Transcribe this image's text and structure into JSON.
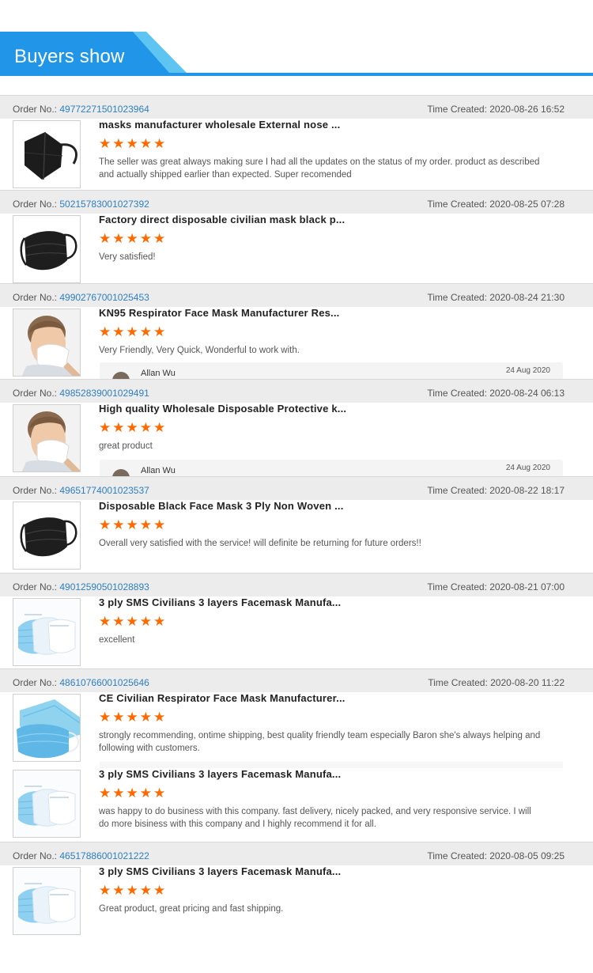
{
  "header": {
    "title": "Buyers show",
    "accent": "#2196e8",
    "accent_light": "#5ec4f2"
  },
  "labels": {
    "order_no": "Order No.:",
    "time_created": "Time Created:"
  },
  "orders": [
    {
      "order_no": "49772271501023964",
      "time": "2020-08-26 16:52",
      "items": [
        {
          "title": "masks manufacturer wholesale External nose ...",
          "rating": 5,
          "comment": "The seller was great always making sure I had all the updates on the status of my order. product as described and actually shipped earlier than expected. Super recomended",
          "thumb": "black-kn95-mask"
        }
      ]
    },
    {
      "order_no": "50215783001027392",
      "time": "2020-08-25 07:28",
      "items": [
        {
          "title": "Factory direct disposable civilian mask black p...",
          "rating": 5,
          "comment": "Very satisfied!",
          "thumb": "black-flat-mask"
        }
      ]
    },
    {
      "order_no": "49902767001025453",
      "time": "2020-08-24 21:30",
      "items": [
        {
          "title": "KN95 Respirator Face Mask Manufacturer Res...",
          "rating": 5,
          "comment": "Very Friendly, Very Quick, Wonderful to work with.",
          "thumb": "man-wearing-kn95",
          "reply": {
            "name": "Allan Wu",
            "date": "24 Aug 2020"
          }
        }
      ]
    },
    {
      "order_no": "49852839001029491",
      "time": "2020-08-24 06:13",
      "items": [
        {
          "title": "High quality Wholesale Disposable Protective k...",
          "rating": 5,
          "comment": "great product",
          "thumb": "man-wearing-mask",
          "reply": {
            "name": "Allan Wu",
            "date": "24 Aug 2020"
          }
        }
      ]
    },
    {
      "order_no": "49651774001023537",
      "time": "2020-08-22 18:17",
      "items": [
        {
          "title": "Disposable Black Face Mask 3 Ply Non Woven ...",
          "rating": 5,
          "comment": "Overall very satisfied with the service! will definite be returning for future orders!!",
          "thumb": "black-flat-mask"
        }
      ]
    },
    {
      "order_no": "49012590501028893",
      "time": "2020-08-21 07:00",
      "items": [
        {
          "title": "3 ply SMS Civilians 3 layers Facemask Manufa...",
          "rating": 5,
          "comment": "excellent",
          "thumb": "blue-layered-mask"
        }
      ]
    },
    {
      "order_no": "48610766001025646",
      "time": "2020-08-20 11:22",
      "items": [
        {
          "title": "CE Civilian Respirator Face Mask Manufacturer...",
          "rating": 5,
          "comment": "strongly recommending, ontime shipping, best quality friendly team especially Baron she's always helping and following with customers.",
          "thumb": "blue-mask-stack"
        },
        {
          "title": "3 ply SMS Civilians 3 layers Facemask Manufa...",
          "rating": 5,
          "comment": "was happy to do business with this company. fast delivery, nicely packed, and very responsive service. I will do more bisiness with this company and I highly recommend it for all.",
          "thumb": "blue-layered-mask"
        }
      ]
    },
    {
      "order_no": "46517886001021222",
      "time": "2020-08-05 09:25",
      "items": [
        {
          "title": "3 ply SMS Civilians 3 layers Facemask Manufa...",
          "rating": 5,
          "comment": "Great product, great pricing and fast shipping.",
          "thumb": "blue-layered-mask"
        }
      ]
    }
  ]
}
